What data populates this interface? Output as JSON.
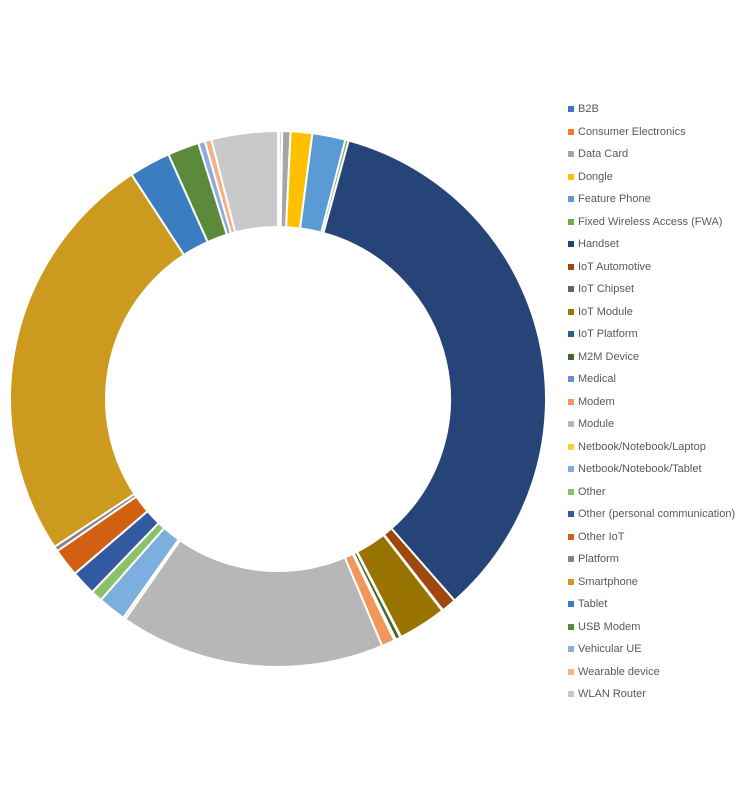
{
  "chart_data": {
    "type": "pie",
    "variant": "doughnut",
    "title": "",
    "unit": "percent (estimated from slice angles)",
    "start_angle_deg": 0,
    "direction": "clockwise",
    "legend_position": "right",
    "slices": [
      {
        "label": "B2B",
        "value": 0.1,
        "color": "#4472C4"
      },
      {
        "label": "Consumer Electronics",
        "value": 0.15,
        "color": "#ED7D31"
      },
      {
        "label": "Data Card",
        "value": 0.5,
        "color": "#A5A5A5"
      },
      {
        "label": "Dongle",
        "value": 1.3,
        "color": "#FFC000"
      },
      {
        "label": "Feature Phone",
        "value": 2.0,
        "color": "#5B9BD5"
      },
      {
        "label": "Fixed Wireless Access (FWA)",
        "value": 0.2,
        "color": "#70AD47"
      },
      {
        "label": "Handset",
        "value": 34.3,
        "color": "#264478"
      },
      {
        "label": "IoT Automotive",
        "value": 0.9,
        "color": "#9E480E"
      },
      {
        "label": "IoT Chipset",
        "value": 0.05,
        "color": "#636363"
      },
      {
        "label": "IoT Module",
        "value": 2.9,
        "color": "#997300"
      },
      {
        "label": "IoT Platform",
        "value": 0.05,
        "color": "#255E91"
      },
      {
        "label": "M2M Device",
        "value": 0.3,
        "color": "#43682B"
      },
      {
        "label": "Medical",
        "value": 0.1,
        "color": "#698ED0"
      },
      {
        "label": "Modem",
        "value": 0.8,
        "color": "#F1975A"
      },
      {
        "label": "Module",
        "value": 16.0,
        "color": "#B7B7B7"
      },
      {
        "label": "Netbook/Notebook/Laptop",
        "value": 0.15,
        "color": "#FFCD33"
      },
      {
        "label": "Netbook/Notebook/Tablet",
        "value": 1.7,
        "color": "#7CAFDD"
      },
      {
        "label": "Other",
        "value": 0.7,
        "color": "#8CC168"
      },
      {
        "label": "Other (personal communication)",
        "value": 1.5,
        "color": "#335AA1"
      },
      {
        "label": "Other IoT",
        "value": 1.7,
        "color": "#D26012"
      },
      {
        "label": "Platform",
        "value": 0.3,
        "color": "#848484"
      },
      {
        "label": "Smartphone",
        "value": 25.1,
        "color": "#CC9A1F"
      },
      {
        "label": "Tablet",
        "value": 2.5,
        "color": "#3A7DC0"
      },
      {
        "label": "USB Modem",
        "value": 1.9,
        "color": "#5A8A3A"
      },
      {
        "label": "Vehicular UE",
        "value": 0.4,
        "color": "#8FAADC"
      },
      {
        "label": "Wearable device",
        "value": 0.4,
        "color": "#F4B183"
      },
      {
        "label": "WLAN Router",
        "value": 4.0,
        "color": "#C9C9C9"
      }
    ]
  }
}
